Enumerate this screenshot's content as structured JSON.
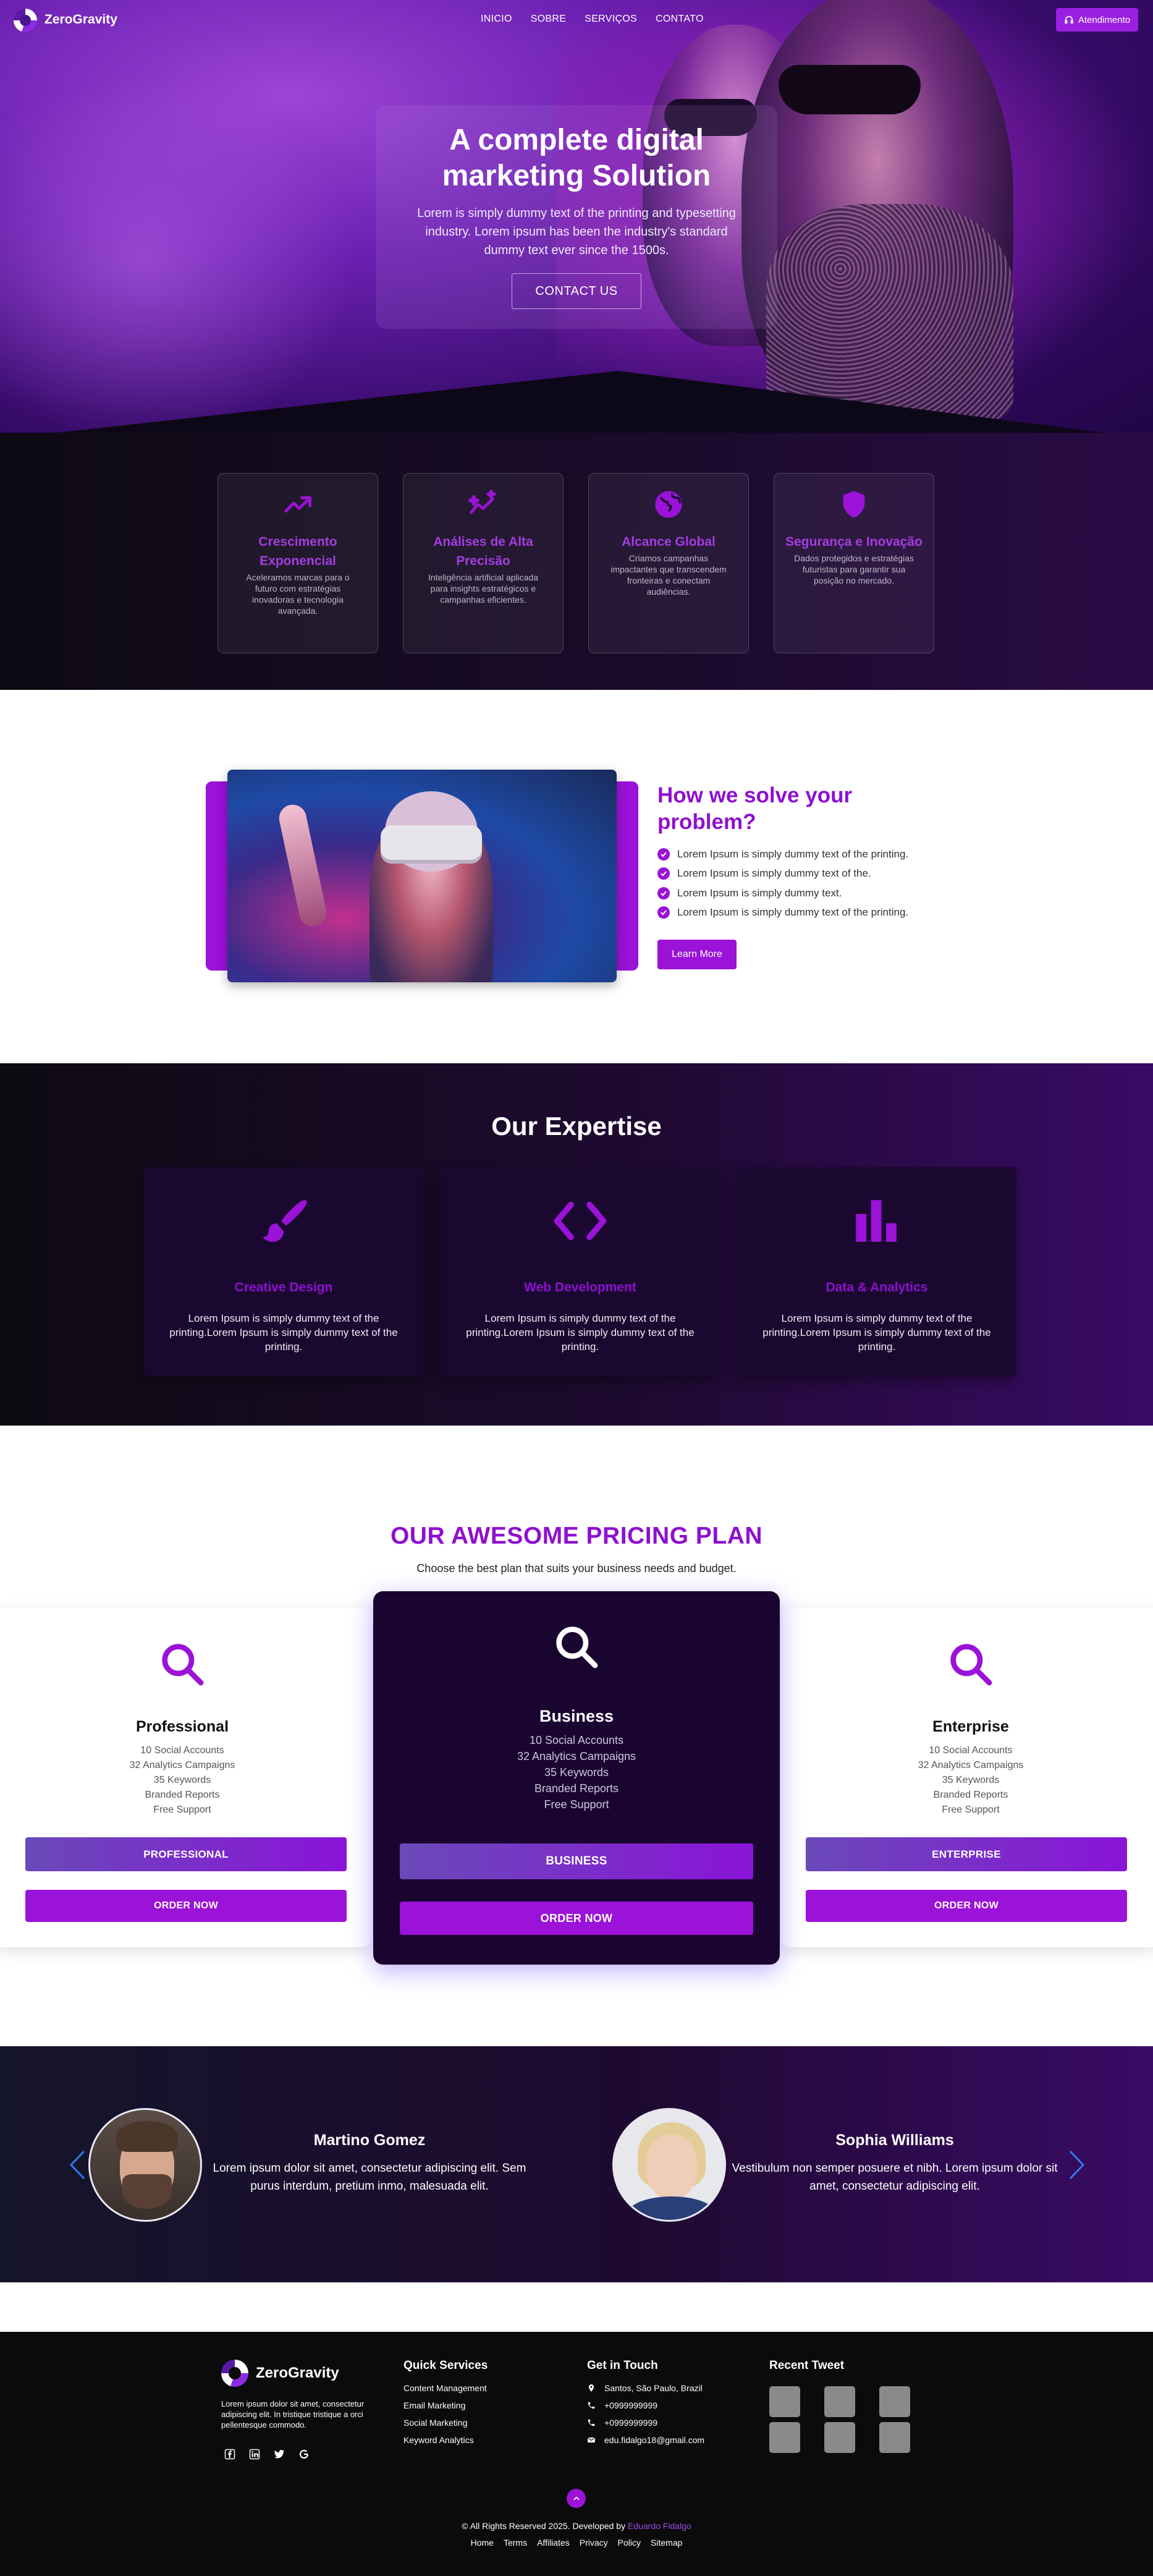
{
  "brand": {
    "name": "ZeroGravity"
  },
  "nav": {
    "items": [
      "INICIO",
      "SOBRE",
      "SERVIÇOS",
      "CONTATO"
    ],
    "support_label": "Atendimento"
  },
  "hero": {
    "title": "A complete digital marketing Solution",
    "text": "Lorem is simply dummy text of the printing and typesetting industry. Lorem ipsum has been the industry's standard dummy text ever since the 1500s.",
    "cta": "CONTACT US"
  },
  "features": [
    {
      "icon": "trending-up-icon",
      "title": "Crescimento Exponencial",
      "text": "Aceleramos marcas para o futuro com estratégias inovadoras e tecnologia avançada."
    },
    {
      "icon": "sparkle-chart-icon",
      "title": "Análises de Alta Precisão",
      "text": "Inteligência artificial aplicada para insights estratégicos e campanhas eficientes."
    },
    {
      "icon": "globe-icon",
      "title": "Alcance Global",
      "text": "Criamos campanhas impactantes que transcendem fronteiras e conectam audiências."
    },
    {
      "icon": "shield-icon",
      "title": "Segurança e Inovação",
      "text": "Dados protegidos e estratégias futuristas para garantir sua posição no mercado."
    }
  ],
  "solve": {
    "title": "How we solve your problem?",
    "items": [
      "Lorem Ipsum is simply dummy text of the printing.",
      "Lorem Ipsum is simply dummy text of the.",
      "Lorem Ipsum is simply dummy text.",
      "Lorem Ipsum is simply dummy text of the printing."
    ],
    "button": "Learn More"
  },
  "expertise": {
    "title": "Our Expertise",
    "cards": [
      {
        "icon": "paintbrush-icon",
        "title": "Creative Design",
        "text": "Lorem Ipsum is simply dummy text of the printing.Lorem Ipsum is simply dummy text of the printing."
      },
      {
        "icon": "code-icon",
        "title": "Web Development",
        "text": "Lorem Ipsum is simply dummy text of the printing.Lorem Ipsum is simply dummy text of the printing."
      },
      {
        "icon": "bar-chart-icon",
        "title": "Data & Analytics",
        "text": "Lorem Ipsum is simply dummy text of the printing.Lorem Ipsum is simply dummy text of the printing."
      }
    ]
  },
  "pricing": {
    "title": "OUR AWESOME PRICING PLAN",
    "subtitle": "Choose the best plan that suits your business needs and budget.",
    "plans": [
      {
        "name": "Professional",
        "features": [
          "10 Social Accounts",
          "32 Analytics Campaigns",
          "35 Keywords",
          "Branded Reports",
          "Free Support"
        ],
        "button": "PROFESSIONAL",
        "order": "ORDER NOW"
      },
      {
        "name": "Business",
        "features": [
          "10 Social Accounts",
          "32 Analytics Campaigns",
          "35 Keywords",
          "Branded Reports",
          "Free Support"
        ],
        "button": "BUSINESS",
        "order": "ORDER NOW"
      },
      {
        "name": "Enterprise",
        "features": [
          "10 Social Accounts",
          "32 Analytics Campaigns",
          "35 Keywords",
          "Branded Reports",
          "Free Support"
        ],
        "button": "ENTERPRISE",
        "order": "ORDER NOW"
      }
    ]
  },
  "testimonials": [
    {
      "name": "Martino Gomez",
      "text": "Lorem ipsum dolor sit amet, consectetur adipiscing elit. Sem purus interdum, pretium inmo, malesuada elit."
    },
    {
      "name": "Sophia Williams",
      "text": "Vestibulum non semper posuere et nibh. Lorem ipsum dolor sit amet, consectetur adipiscing elit."
    }
  ],
  "footer": {
    "brand": "ZeroGravity",
    "about": "Lorem ipsum dolor sit amet, consectetur adipiscing elit. In tristique tristique a orci pellentesque commodo.",
    "services_title": "Quick Services",
    "services": [
      "Content Management",
      "Email Marketing",
      "Social Marketing",
      "Keyword Analytics"
    ],
    "contact_title": "Get in Touch",
    "contact": [
      {
        "icon": "location-pin-icon",
        "text": "Santos, São Paulo, Brazil"
      },
      {
        "icon": "phone-icon",
        "text": "+0999999999"
      },
      {
        "icon": "phone-icon",
        "text": "+0999999999"
      },
      {
        "icon": "mail-icon",
        "text": "edu.fidalgo18@gmail.com"
      }
    ],
    "tweets_title": "Recent Tweet",
    "copyright_prefix": "© All Rights Reserved 2025. Developed by",
    "developer": "Eduardo Fidalgo",
    "links": [
      "Home",
      "Terms",
      "Affiliates",
      "Privacy",
      "Policy",
      "Sitemap"
    ]
  },
  "colors": {
    "accent": "#9b12d8",
    "title_purple": "#8e10cf",
    "dark_bg": "#0b0b0b"
  }
}
